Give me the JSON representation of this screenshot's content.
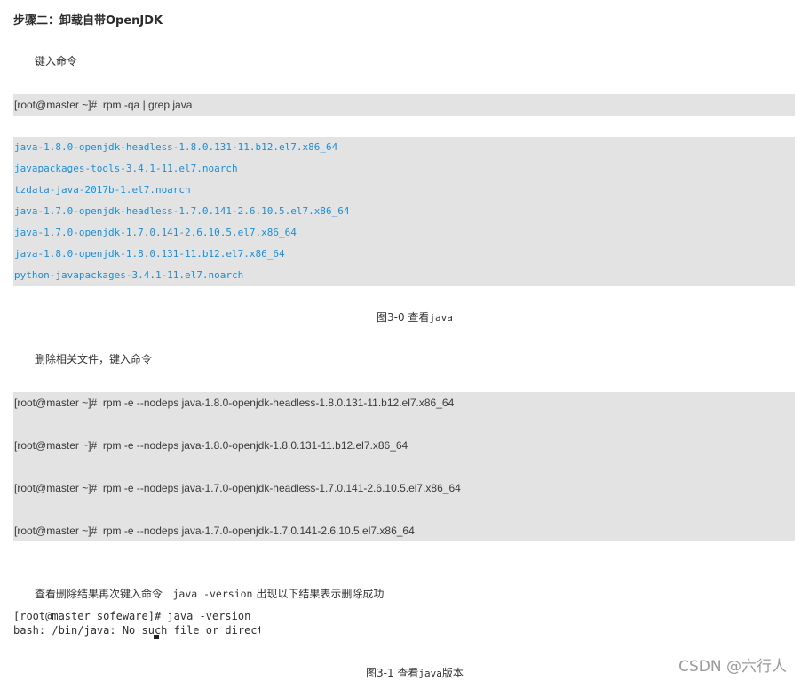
{
  "step_heading": "步骤二：卸载自带OpenJDK",
  "intro_text": "键入命令",
  "query_command": "[root@master ~]#  rpm -qa | grep java",
  "query_output": [
    "java-1.8.0-openjdk-headless-1.8.0.131-11.b12.el7.x86_64",
    "javapackages-tools-3.4.1-11.el7.noarch",
    "tzdata-java-2017b-1.el7.noarch",
    "java-1.7.0-openjdk-headless-1.7.0.141-2.6.10.5.el7.x86_64",
    "java-1.7.0-openjdk-1.7.0.141-2.6.10.5.el7.x86_64",
    "java-1.8.0-openjdk-1.8.0.131-11.b12.el7.x86_64",
    "python-javapackages-3.4.1-11.el7.noarch"
  ],
  "figure1_caption": {
    "label": "图3-0 查看",
    "code": "java"
  },
  "remove_text": "删除相关文件，键入命令",
  "remove_commands": [
    "[root@master ~]#  rpm -e --nodeps java-1.8.0-openjdk-headless-1.8.0.131-11.b12.el7.x86_64",
    "[root@master ~]#  rpm -e --nodeps java-1.8.0-openjdk-1.8.0.131-11.b12.el7.x86_64",
    "[root@master ~]#  rpm -e --nodeps java-1.7.0-openjdk-headless-1.7.0.141-2.6.10.5.el7.x86_64",
    "[root@master ~]#  rpm -e --nodeps java-1.7.0-openjdk-1.7.0.141-2.6.10.5.el7.x86_64"
  ],
  "verify_text": {
    "before": "查看删除结果再次键入命令",
    "code": "java -version",
    "after": "出现以下结果表示删除成功"
  },
  "terminal": {
    "line1": "[root@master sofeware]# java -version",
    "line2": "bash: /bin/java: No such file or directory"
  },
  "figure2_caption": {
    "label_before": "图3-1 查看",
    "code": "java",
    "label_after": "版本"
  },
  "watermark": "CSDN @六行人",
  "colors": {
    "code_background": "#e3e3e3",
    "output_text": "#1b8fd6"
  }
}
